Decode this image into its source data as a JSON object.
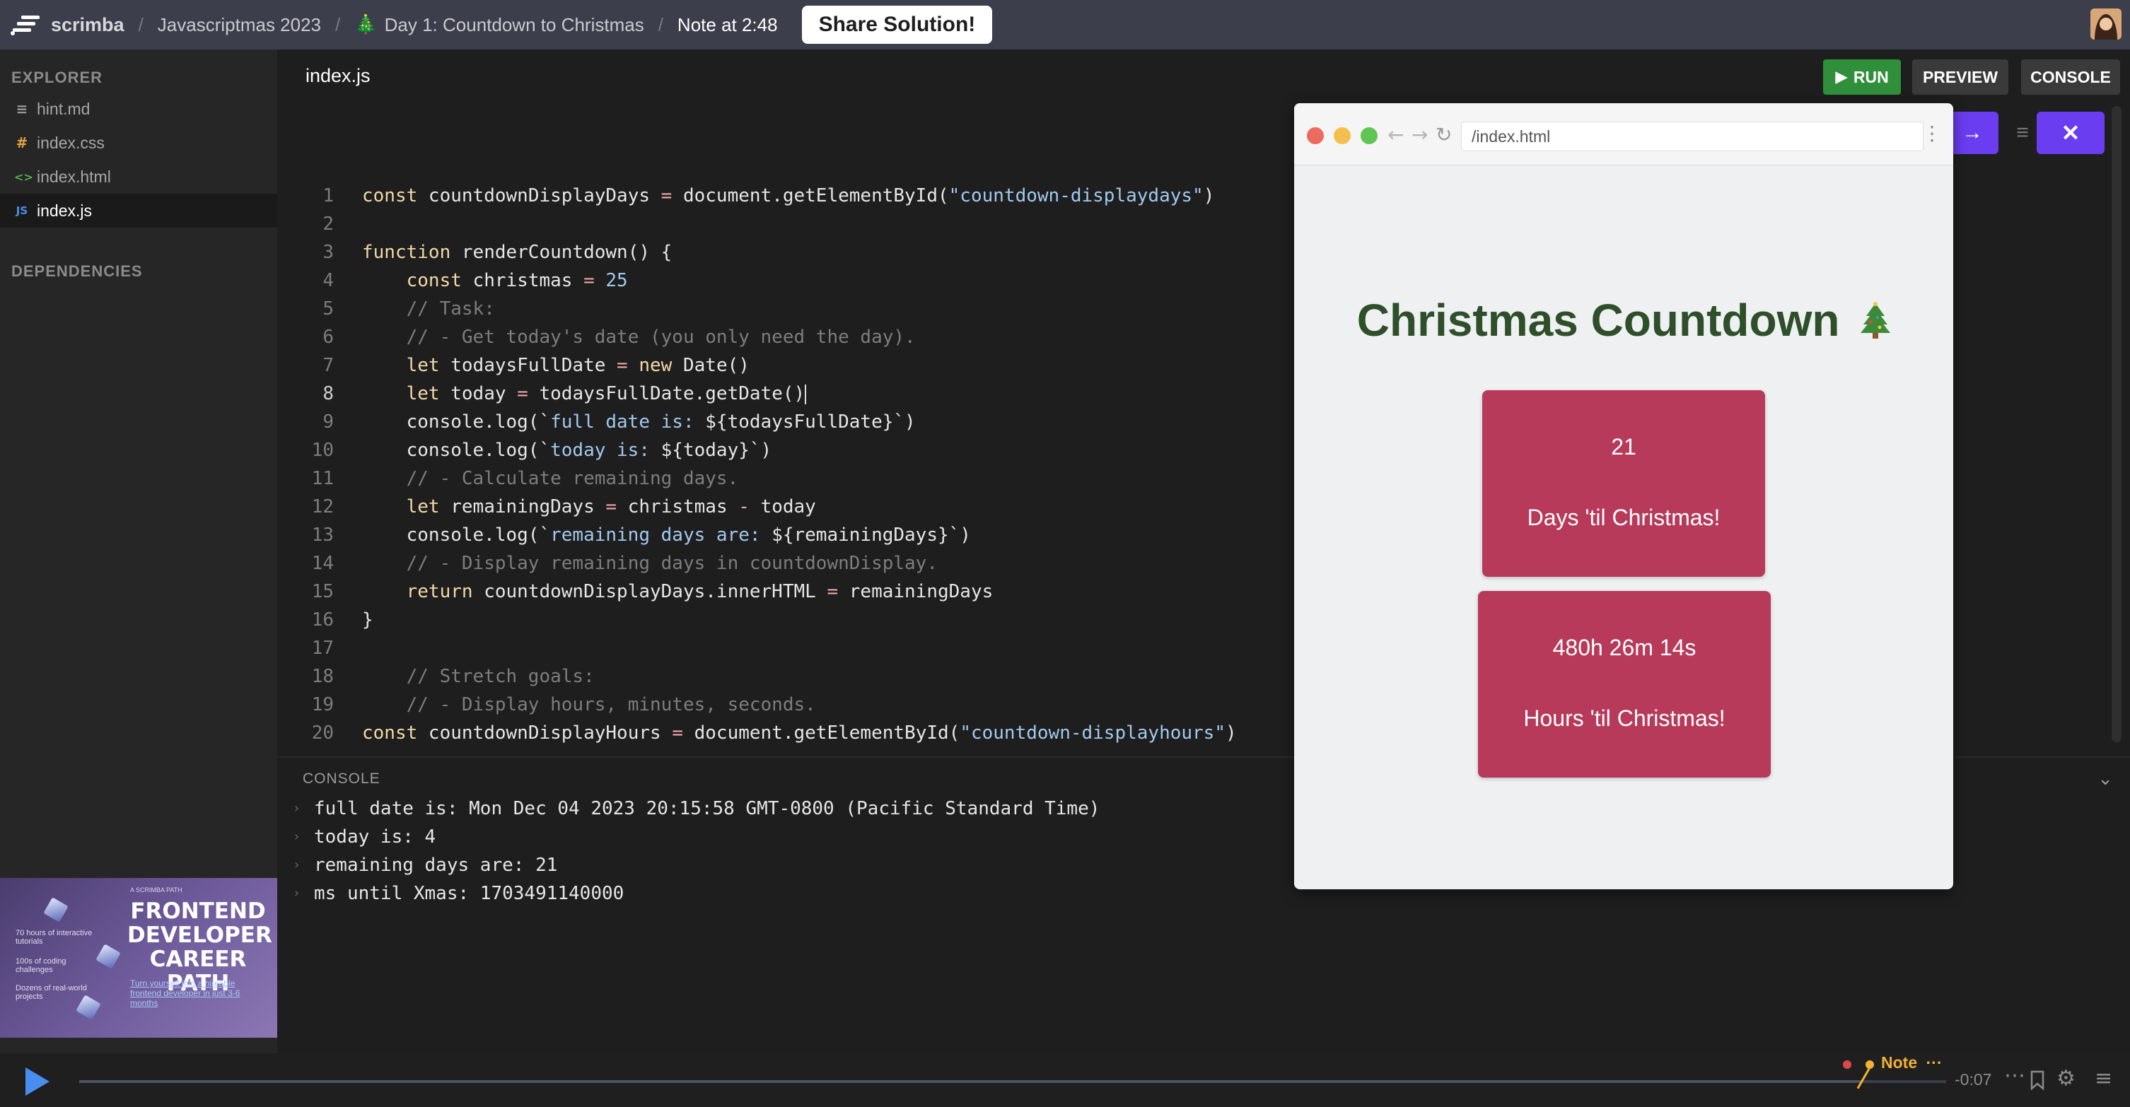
{
  "topbar": {
    "brand": "scrimba",
    "course": "Javascriptmas 2023",
    "lesson_emoji": "🎄",
    "lesson": "Day 1: Countdown to Christmas",
    "note": "Note at 2:48",
    "share_label": "Share Solution!"
  },
  "sidebar": {
    "explorer_heading": "EXPLORER",
    "files": [
      {
        "name": "hint.md",
        "icon": "≡",
        "icon_color": "#9a9a9a"
      },
      {
        "name": "index.css",
        "icon": "#",
        "icon_color": "#e5a33d"
      },
      {
        "name": "index.html",
        "icon": "<>",
        "icon_color": "#55b04c"
      },
      {
        "name": "index.js",
        "icon": "JS",
        "icon_color": "#4a90e2"
      }
    ],
    "dependencies_heading": "DEPENDENCIES",
    "promo": {
      "title": "FRONTEND DEVELOPER CAREER PATH",
      "tag": "A SCRIMBA PATH",
      "bullet1": "70 hours of interactive tutorials",
      "bullet2": "100s of coding challenges",
      "bullet3": "Dozens of real-world projects",
      "link": "Turn yourself into a hireable frontend developer in just 3-6 months"
    }
  },
  "editor": {
    "active_tab": "index.js",
    "run_label": "RUN",
    "preview_label": "PREVIEW",
    "console_label": "CONSOLE",
    "current_line": 8
  },
  "console": {
    "title": "CONSOLE",
    "lines": [
      "full date is: Mon Dec 04 2023 20:15:58 GMT-0800 (Pacific Standard Time)",
      "today is: 4",
      "remaining days are: 21",
      "ms until Xmas: 1703491140000"
    ]
  },
  "preview": {
    "url": "/index.html",
    "title": "Christmas Countdown",
    "days_value": "21",
    "days_label": "Days 'til Christmas!",
    "hours_value": "480h 26m 14s",
    "hours_label": "Hours 'til Christmas!"
  },
  "player": {
    "note_label": "Note",
    "time_remaining": "-0:07",
    "progress_fraction": 0.955
  },
  "colors": {
    "accent_purple": "#6a3df0",
    "run_green": "#2f8f3b",
    "card_red": "#b83a5a",
    "note_yellow": "#f2b233"
  }
}
